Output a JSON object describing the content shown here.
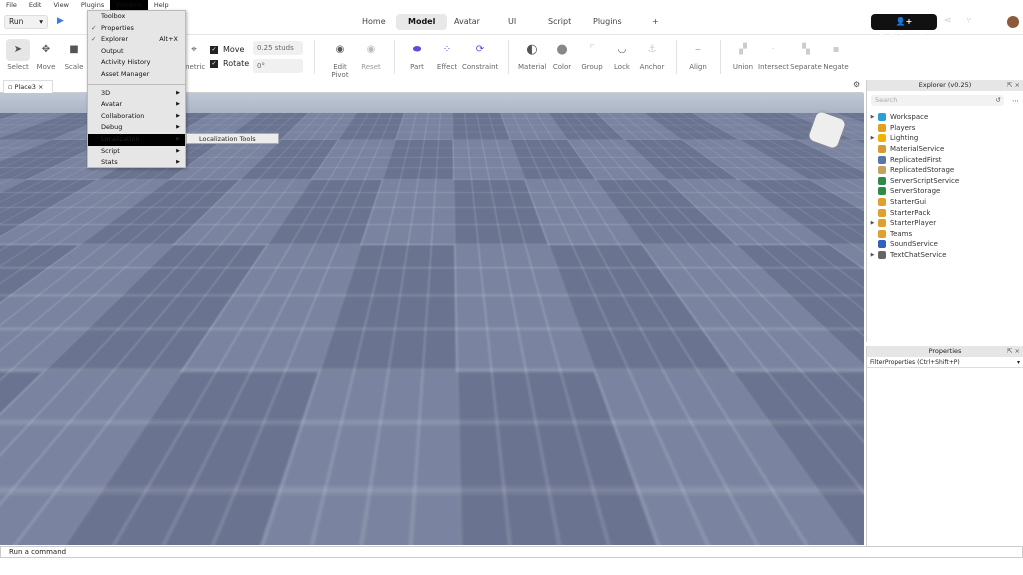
{
  "menubar": [
    "File",
    "Edit",
    "View",
    "Plugins",
    "Window",
    "Help"
  ],
  "run": {
    "label": "Run"
  },
  "ribbon_tabs": [
    "Home",
    "Model",
    "Avatar",
    "UI",
    "Script",
    "Plugins",
    "+"
  ],
  "collaborate": "Collaborate",
  "tools": {
    "select": "Select",
    "move": "Move",
    "scale": "Scale",
    "geometric": "metric",
    "move_chk": "Move",
    "rotate_chk": "Rotate",
    "studs": "0.25 studs",
    "degrees": "0°",
    "edit_pivot": "Edit Pivot",
    "reset": "Reset",
    "part": "Part",
    "effect": "Effect",
    "constraint": "Constraint",
    "material": "Material",
    "color": "Color",
    "group": "Group",
    "lock": "Lock",
    "anchor": "Anchor",
    "align": "Align",
    "union": "Union",
    "intersect": "Intersect",
    "separate": "Separate",
    "negate": "Negate"
  },
  "doc_tab": "Place3",
  "window_menu": {
    "items": [
      {
        "label": "Toolbox"
      },
      {
        "label": "Properties",
        "checked": true
      },
      {
        "label": "Explorer",
        "checked": true,
        "shortcut": "Alt+X"
      },
      {
        "label": "Output"
      },
      {
        "label": "Activity History"
      },
      {
        "label": "Asset Manager"
      },
      {
        "label": "3D",
        "sub": true
      },
      {
        "label": "Avatar",
        "sub": true
      },
      {
        "label": "Collaboration",
        "sub": true
      },
      {
        "label": "Debug",
        "sub": true
      },
      {
        "label": "Localization",
        "sub": true,
        "highlighted": true
      },
      {
        "label": "Script",
        "sub": true
      },
      {
        "label": "Stats",
        "sub": true
      }
    ],
    "submenu": "Localization Tools"
  },
  "explorer": {
    "title": "Explorer (v0.25)",
    "search_placeholder": "Search",
    "items": [
      {
        "label": "Workspace",
        "exp": true,
        "color": "#2a9fd6"
      },
      {
        "label": "Players",
        "color": "#e0a020"
      },
      {
        "label": "Lighting",
        "exp": true,
        "color": "#f0b400"
      },
      {
        "label": "MaterialService",
        "color": "#d89a30"
      },
      {
        "label": "ReplicatedFirst",
        "color": "#5577aa"
      },
      {
        "label": "ReplicatedStorage",
        "color": "#c8a060"
      },
      {
        "label": "ServerScriptService",
        "color": "#2f8a4a"
      },
      {
        "label": "ServerStorage",
        "color": "#2f8a4a"
      },
      {
        "label": "StarterGui",
        "color": "#e0a030"
      },
      {
        "label": "StarterPack",
        "color": "#e0a030"
      },
      {
        "label": "StarterPlayer",
        "exp": true,
        "color": "#e0a030"
      },
      {
        "label": "Teams",
        "color": "#e0a030"
      },
      {
        "label": "SoundService",
        "color": "#3060c0"
      },
      {
        "label": "TextChatService",
        "exp": true,
        "color": "#666666"
      }
    ]
  },
  "properties": {
    "title": "Properties",
    "filter": "FilterProperties (Ctrl+Shift+P)"
  },
  "command_bar": {
    "placeholder": "Run a command"
  }
}
